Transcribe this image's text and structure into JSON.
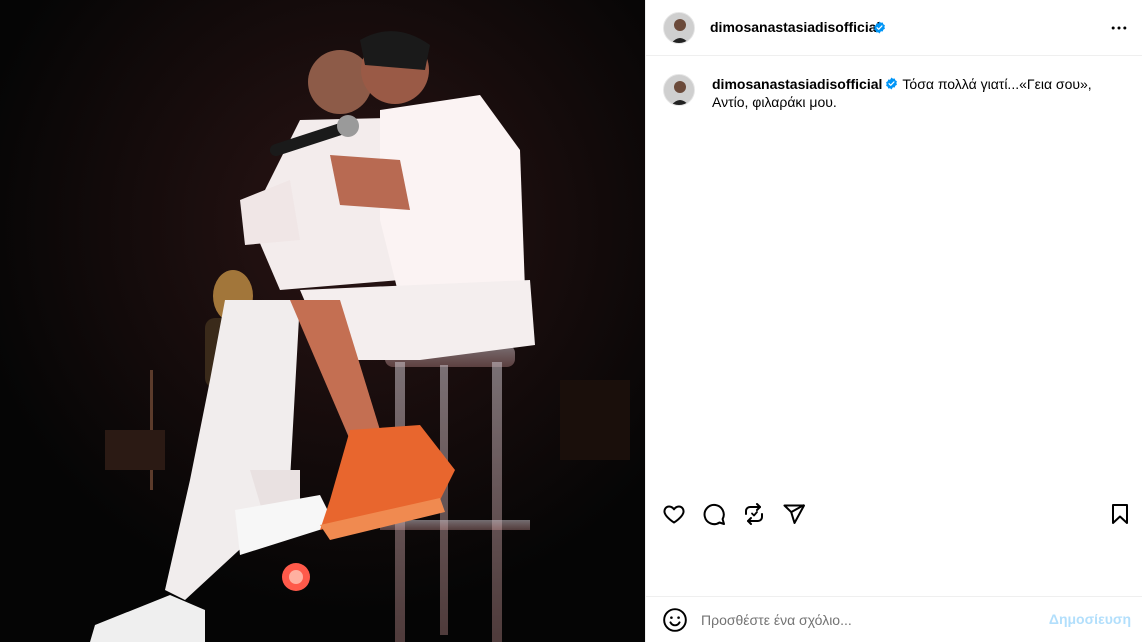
{
  "post": {
    "username": "dimosanastasiadisofficial",
    "caption_username": "dimosanastasiadisofficial",
    "caption_text": "Τόσα πολλά γιατί...«Γεια σου», Αντίο, φιλαράκι μου."
  },
  "comment": {
    "placeholder": "Προσθέστε ένα σχόλιο...",
    "post_label": "Δημοσίευση"
  },
  "icons": {
    "verified": "verified-badge-icon",
    "more": "more-options-icon",
    "like": "heart-icon",
    "comment": "comment-bubble-icon",
    "repost": "repost-icon",
    "share": "paper-plane-icon",
    "save": "bookmark-icon",
    "emoji": "smiley-icon"
  },
  "colors": {
    "verified": "#0095f6",
    "post_button": "#b2dffc",
    "placeholder": "#737373",
    "photo_background": "#050505"
  }
}
